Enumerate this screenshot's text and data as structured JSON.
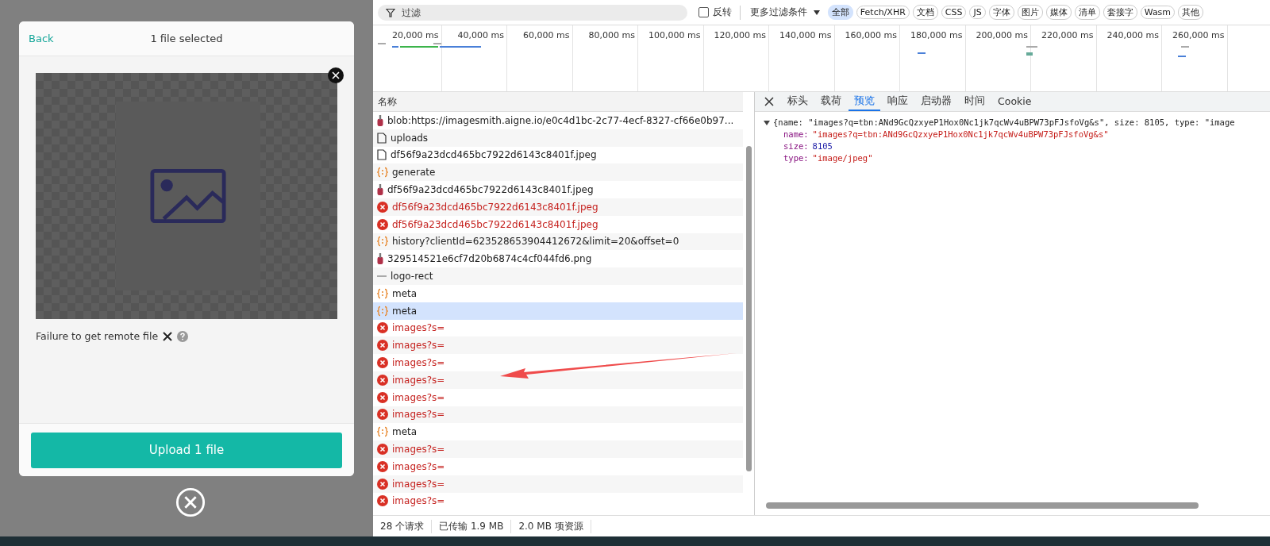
{
  "modal": {
    "back": "Back",
    "title": "1 file selected",
    "message": "Failure to get remote file",
    "upload_button": "Upload 1 file"
  },
  "devtools": {
    "filter": {
      "placeholder": "过滤",
      "invert": {
        "label": "反转",
        "checked": false
      },
      "more": "更多过滤条件"
    },
    "chips": [
      {
        "label": "全部",
        "selected": true
      },
      {
        "label": "Fetch/XHR",
        "selected": false
      },
      {
        "label": "文档",
        "selected": false
      },
      {
        "label": "CSS",
        "selected": false
      },
      {
        "label": "JS",
        "selected": false
      },
      {
        "label": "字体",
        "selected": false
      },
      {
        "label": "图片",
        "selected": false
      },
      {
        "label": "媒体",
        "selected": false
      },
      {
        "label": "清单",
        "selected": false
      },
      {
        "label": "套接字",
        "selected": false
      },
      {
        "label": "Wasm",
        "selected": false
      },
      {
        "label": "其他",
        "selected": false
      }
    ],
    "timeline_ticks": [
      "20,000 ms",
      "40,000 ms",
      "60,000 ms",
      "80,000 ms",
      "100,000 ms",
      "120,000 ms",
      "140,000 ms",
      "160,000 ms",
      "180,000 ms",
      "200,000 ms",
      "220,000 ms",
      "240,000 ms",
      "260,000 ms"
    ],
    "list_header": "名称",
    "requests": [
      {
        "kind": "image",
        "name": "blob:https://imagesmith.aigne.io/e0c4d1bc-2c77-4ecf-8327-cf66e0b97...",
        "selected": false
      },
      {
        "kind": "document",
        "name": "uploads",
        "selected": false
      },
      {
        "kind": "document",
        "name": "df56f9a23dcd465bc7922d6143c8401f.jpeg",
        "selected": false
      },
      {
        "kind": "fetch",
        "name": "generate",
        "selected": false
      },
      {
        "kind": "image",
        "name": "df56f9a23dcd465bc7922d6143c8401f.jpeg",
        "selected": false
      },
      {
        "kind": "error",
        "name": "df56f9a23dcd465bc7922d6143c8401f.jpeg",
        "selected": false
      },
      {
        "kind": "error",
        "name": "df56f9a23dcd465bc7922d6143c8401f.jpeg",
        "selected": false
      },
      {
        "kind": "fetch",
        "name": "history?clientId=623528653904412672&limit=20&offset=0",
        "selected": false
      },
      {
        "kind": "image",
        "name": "329514521e6cf7d20b6874c4cf044fd6.png",
        "selected": false
      },
      {
        "kind": "other",
        "name": "logo-rect",
        "selected": false
      },
      {
        "kind": "fetch",
        "name": "meta",
        "selected": false
      },
      {
        "kind": "fetch",
        "name": "meta",
        "selected": true
      },
      {
        "kind": "error",
        "name": "images?s=",
        "selected": false
      },
      {
        "kind": "error",
        "name": "images?s=",
        "selected": false
      },
      {
        "kind": "error",
        "name": "images?s=",
        "selected": false
      },
      {
        "kind": "error",
        "name": "images?s=",
        "selected": false
      },
      {
        "kind": "error",
        "name": "images?s=",
        "selected": false
      },
      {
        "kind": "error",
        "name": "images?s=",
        "selected": false
      },
      {
        "kind": "fetch",
        "name": "meta",
        "selected": false
      },
      {
        "kind": "error",
        "name": "images?s=",
        "selected": false
      },
      {
        "kind": "error",
        "name": "images?s=",
        "selected": false
      },
      {
        "kind": "error",
        "name": "images?s=",
        "selected": false
      },
      {
        "kind": "error",
        "name": "images?s=",
        "selected": false
      }
    ],
    "status": [
      "28 个请求",
      "已传输 1.9 MB",
      "2.0 MB 项资源"
    ],
    "tabs": [
      {
        "label": "标头",
        "selected": false
      },
      {
        "label": "载荷",
        "selected": false
      },
      {
        "label": "预览",
        "selected": true
      },
      {
        "label": "响应",
        "selected": false
      },
      {
        "label": "启动器",
        "selected": false
      },
      {
        "label": "时间",
        "selected": false
      },
      {
        "label": "Cookie",
        "selected": false
      }
    ],
    "preview": {
      "summary": "{name: \"images?q=tbn:ANd9GcQzxyeP1Hox0Nc1jk7qcWv4uBPW73pFJsfoVg&s\", size: 8105, type: \"image",
      "expanded": true,
      "properties": [
        {
          "key": "name:",
          "kind": "string",
          "value": "\"images?q=tbn:ANd9GcQzxyeP1Hox0Nc1jk7qcWv4uBPW73pFJsfoVg&s\""
        },
        {
          "key": "size:",
          "kind": "number",
          "value": "8105"
        },
        {
          "key": "type:",
          "kind": "string",
          "value": "\"image/jpeg\""
        }
      ]
    }
  }
}
